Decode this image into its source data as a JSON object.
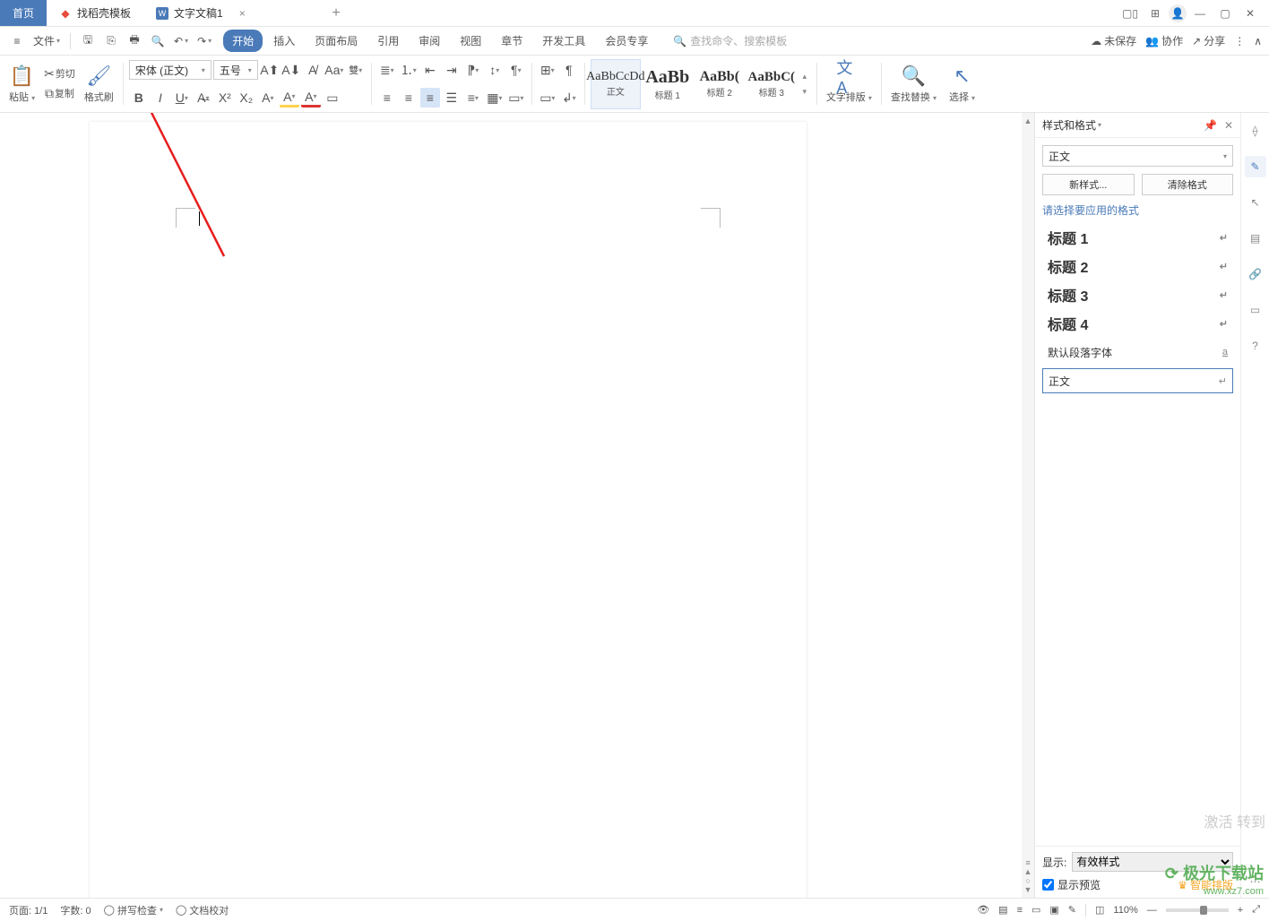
{
  "tabs": {
    "home": "首页",
    "templates": "找稻壳模板",
    "doc": "文字文稿1"
  },
  "menubar": {
    "file": "文件",
    "tabs": [
      "开始",
      "插入",
      "页面布局",
      "引用",
      "审阅",
      "视图",
      "章节",
      "开发工具",
      "会员专享"
    ],
    "search_ph": "查找命令、搜索模板",
    "unsaved": "未保存",
    "collab": "协作",
    "share": "分享"
  },
  "ribbon": {
    "paste": "粘贴",
    "cut": "剪切",
    "copy": "复制",
    "format_painter": "格式刷",
    "font_name": "宋体 (正文)",
    "font_size": "五号",
    "styles": [
      {
        "preview": "AaBbCcDd",
        "name": "正文"
      },
      {
        "preview": "AaBb",
        "name": "标题 1"
      },
      {
        "preview": "AaBb(",
        "name": "标题 2"
      },
      {
        "preview": "AaBbC(",
        "name": "标题 3"
      }
    ],
    "text_layout": "文字排版",
    "find_replace": "查找替换",
    "select": "选择"
  },
  "side": {
    "title": "样式和格式",
    "current": "正文",
    "new_style": "新样式...",
    "clear": "清除格式",
    "hint": "请选择要应用的格式",
    "list": [
      "标题 1",
      "标题 2",
      "标题 3",
      "标题 4"
    ],
    "para_font": "默认段落字体",
    "body_text": "正文",
    "display": "显示:",
    "display_opt": "有效样式",
    "show_preview": "显示预览",
    "smart": "智能排版"
  },
  "status": {
    "page": "页面: 1/1",
    "words": "字数: 0",
    "spell": "拼写检查",
    "proof": "文档校对",
    "zoom": "110%"
  },
  "watermark": {
    "l1": "极光下载站",
    "l2": "www.xz7.com"
  },
  "activate": "激活\n转到"
}
